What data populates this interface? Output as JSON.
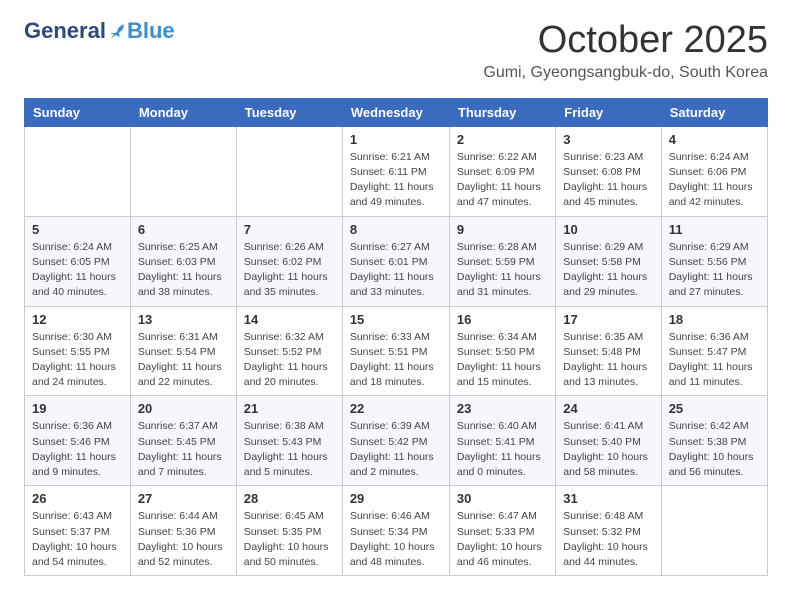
{
  "header": {
    "logo_general": "General",
    "logo_blue": "Blue",
    "month_title": "October 2025",
    "location": "Gumi, Gyeongsangbuk-do, South Korea"
  },
  "weekdays": [
    "Sunday",
    "Monday",
    "Tuesday",
    "Wednesday",
    "Thursday",
    "Friday",
    "Saturday"
  ],
  "weeks": [
    [
      {
        "day": "",
        "info": ""
      },
      {
        "day": "",
        "info": ""
      },
      {
        "day": "",
        "info": ""
      },
      {
        "day": "1",
        "info": "Sunrise: 6:21 AM\nSunset: 6:11 PM\nDaylight: 11 hours\nand 49 minutes."
      },
      {
        "day": "2",
        "info": "Sunrise: 6:22 AM\nSunset: 6:09 PM\nDaylight: 11 hours\nand 47 minutes."
      },
      {
        "day": "3",
        "info": "Sunrise: 6:23 AM\nSunset: 6:08 PM\nDaylight: 11 hours\nand 45 minutes."
      },
      {
        "day": "4",
        "info": "Sunrise: 6:24 AM\nSunset: 6:06 PM\nDaylight: 11 hours\nand 42 minutes."
      }
    ],
    [
      {
        "day": "5",
        "info": "Sunrise: 6:24 AM\nSunset: 6:05 PM\nDaylight: 11 hours\nand 40 minutes."
      },
      {
        "day": "6",
        "info": "Sunrise: 6:25 AM\nSunset: 6:03 PM\nDaylight: 11 hours\nand 38 minutes."
      },
      {
        "day": "7",
        "info": "Sunrise: 6:26 AM\nSunset: 6:02 PM\nDaylight: 11 hours\nand 35 minutes."
      },
      {
        "day": "8",
        "info": "Sunrise: 6:27 AM\nSunset: 6:01 PM\nDaylight: 11 hours\nand 33 minutes."
      },
      {
        "day": "9",
        "info": "Sunrise: 6:28 AM\nSunset: 5:59 PM\nDaylight: 11 hours\nand 31 minutes."
      },
      {
        "day": "10",
        "info": "Sunrise: 6:29 AM\nSunset: 5:58 PM\nDaylight: 11 hours\nand 29 minutes."
      },
      {
        "day": "11",
        "info": "Sunrise: 6:29 AM\nSunset: 5:56 PM\nDaylight: 11 hours\nand 27 minutes."
      }
    ],
    [
      {
        "day": "12",
        "info": "Sunrise: 6:30 AM\nSunset: 5:55 PM\nDaylight: 11 hours\nand 24 minutes."
      },
      {
        "day": "13",
        "info": "Sunrise: 6:31 AM\nSunset: 5:54 PM\nDaylight: 11 hours\nand 22 minutes."
      },
      {
        "day": "14",
        "info": "Sunrise: 6:32 AM\nSunset: 5:52 PM\nDaylight: 11 hours\nand 20 minutes."
      },
      {
        "day": "15",
        "info": "Sunrise: 6:33 AM\nSunset: 5:51 PM\nDaylight: 11 hours\nand 18 minutes."
      },
      {
        "day": "16",
        "info": "Sunrise: 6:34 AM\nSunset: 5:50 PM\nDaylight: 11 hours\nand 15 minutes."
      },
      {
        "day": "17",
        "info": "Sunrise: 6:35 AM\nSunset: 5:48 PM\nDaylight: 11 hours\nand 13 minutes."
      },
      {
        "day": "18",
        "info": "Sunrise: 6:36 AM\nSunset: 5:47 PM\nDaylight: 11 hours\nand 11 minutes."
      }
    ],
    [
      {
        "day": "19",
        "info": "Sunrise: 6:36 AM\nSunset: 5:46 PM\nDaylight: 11 hours\nand 9 minutes."
      },
      {
        "day": "20",
        "info": "Sunrise: 6:37 AM\nSunset: 5:45 PM\nDaylight: 11 hours\nand 7 minutes."
      },
      {
        "day": "21",
        "info": "Sunrise: 6:38 AM\nSunset: 5:43 PM\nDaylight: 11 hours\nand 5 minutes."
      },
      {
        "day": "22",
        "info": "Sunrise: 6:39 AM\nSunset: 5:42 PM\nDaylight: 11 hours\nand 2 minutes."
      },
      {
        "day": "23",
        "info": "Sunrise: 6:40 AM\nSunset: 5:41 PM\nDaylight: 11 hours\nand 0 minutes."
      },
      {
        "day": "24",
        "info": "Sunrise: 6:41 AM\nSunset: 5:40 PM\nDaylight: 10 hours\nand 58 minutes."
      },
      {
        "day": "25",
        "info": "Sunrise: 6:42 AM\nSunset: 5:38 PM\nDaylight: 10 hours\nand 56 minutes."
      }
    ],
    [
      {
        "day": "26",
        "info": "Sunrise: 6:43 AM\nSunset: 5:37 PM\nDaylight: 10 hours\nand 54 minutes."
      },
      {
        "day": "27",
        "info": "Sunrise: 6:44 AM\nSunset: 5:36 PM\nDaylight: 10 hours\nand 52 minutes."
      },
      {
        "day": "28",
        "info": "Sunrise: 6:45 AM\nSunset: 5:35 PM\nDaylight: 10 hours\nand 50 minutes."
      },
      {
        "day": "29",
        "info": "Sunrise: 6:46 AM\nSunset: 5:34 PM\nDaylight: 10 hours\nand 48 minutes."
      },
      {
        "day": "30",
        "info": "Sunrise: 6:47 AM\nSunset: 5:33 PM\nDaylight: 10 hours\nand 46 minutes."
      },
      {
        "day": "31",
        "info": "Sunrise: 6:48 AM\nSunset: 5:32 PM\nDaylight: 10 hours\nand 44 minutes."
      },
      {
        "day": "",
        "info": ""
      }
    ]
  ]
}
